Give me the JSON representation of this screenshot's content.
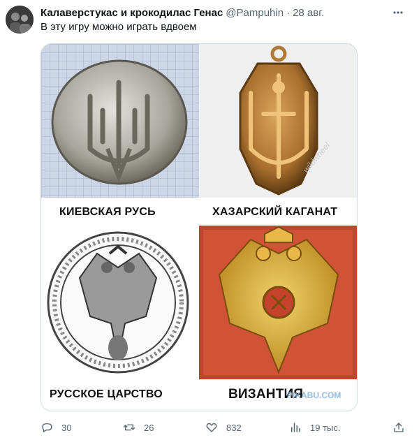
{
  "tweet": {
    "author_name": "Калаверстукас и крокодилас Генас",
    "handle": "@Pampuhin",
    "separator": "·",
    "date": "28 авг.",
    "text": "В эту игру можно играть вдвоем"
  },
  "media": {
    "captions": [
      "КИЕВСКАЯ РУСЬ",
      "ХАЗАРСКИЙ КАГАНАТ",
      "РУССКОЕ ЦАРСТВО",
      "ВИЗАНТИЯ"
    ],
    "watermarks": [
      "wildwheel",
      "PIKABU.COM"
    ]
  },
  "actions": {
    "replies": "30",
    "retweets": "26",
    "likes": "832",
    "views": "19 тыс."
  },
  "icons": [
    "more-icon",
    "reply-icon",
    "retweet-icon",
    "like-icon",
    "views-icon",
    "share-icon"
  ],
  "colors": {
    "muted": "#536471",
    "border": "#cfd9de",
    "text": "#0f1419"
  }
}
